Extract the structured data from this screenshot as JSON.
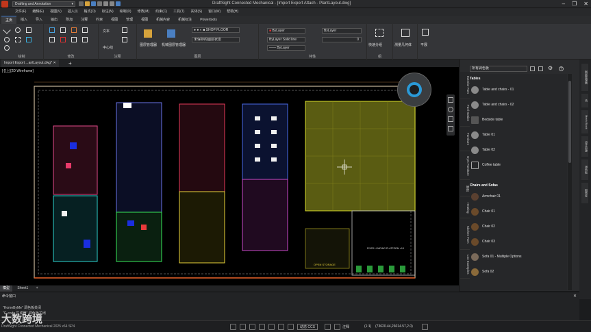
{
  "titlebar": {
    "workspace": "Drafting and Annotation",
    "title": "DraftSight Connected Mechanical - [Import Export Attach - PlantLayout.dwg]"
  },
  "menu": [
    "文件(F)",
    "编辑(E)",
    "视图(V)",
    "插入(I)",
    "格式(O)",
    "标注(N)",
    "绘制(D)",
    "修改(M)",
    "约束(C)",
    "工具(T)",
    "实体(S)",
    "窗口(W)",
    "帮助(H)"
  ],
  "ribbon_tabs": [
    "主页",
    "插入",
    "导入",
    "输出",
    "附加",
    "注释",
    "约束",
    "视图",
    "管理",
    "视图",
    "机械内容",
    "机械标注",
    "Powertools"
  ],
  "ribbon": {
    "draw_label": "绘制",
    "modify_label": "修改",
    "text_label": "文本",
    "annotation_label": "注释",
    "center_label": "中心线",
    "layers_label": "图层",
    "layer_name": "SHOP FLOOR",
    "layer_state": "未保存的图层状态",
    "props_label": "特性",
    "bylayer": "ByLayer",
    "solid_line": "Solid line",
    "zero": "0",
    "group_label": "组",
    "quick_group": "快速分组",
    "measure": "测量几何体",
    "flat": "平展",
    "layout_mgr": "图层管理器",
    "mech_layer": "机械图层管理器"
  },
  "doc_tab": "Import Export ...antLayout.dwg*",
  "view_label": "[-][上][2D Wireframe]",
  "layout_tabs": [
    "模型",
    "Sheet1"
  ],
  "palette": {
    "search_label": "所有调色板",
    "side_tabs": [
      "Exterior Furn",
      "Fuel Station",
      "Furniture",
      "Gym Furniture",
      "厨房",
      "Heating",
      "Kitchen Furn",
      "Loo Examples"
    ],
    "far_tabs": [
      "图层管理器",
      "块",
      "Mech Block",
      "设计资源",
      "调色板",
      "图案库"
    ],
    "sections": [
      {
        "header": "Tables",
        "items": [
          "Table and chairs - 01",
          "Table and chairs - 02",
          "Bedside table",
          "Table 01",
          "Table 02",
          "Coffee table"
        ]
      },
      {
        "header": "Chairs and Sofas",
        "items": [
          "Armchair 01",
          "Chair 01",
          "Chair 02",
          "Chair 03",
          "Sofa 01 - Multiple Options",
          "Sofa 02"
        ]
      }
    ]
  },
  "command": {
    "title": "命令窗口",
    "lines": [
      "\"HomeByMe\" 调色板关闭",
      "\"G-code 生成器\" 调色板关闭"
    ]
  },
  "status": {
    "version": "DraftSight Connected Mechanical 2025 x64 SP4",
    "dyn": "动态 CCS",
    "annot": "注释",
    "scale": "(1:1)",
    "coords": "(73620.44,26014.57,2.0)"
  },
  "watermark": "大数跨境",
  "plan_labels": {
    "storage": "OPEN STORAGE",
    "platform": "FIXED LOADING PLATFORM ×18"
  }
}
